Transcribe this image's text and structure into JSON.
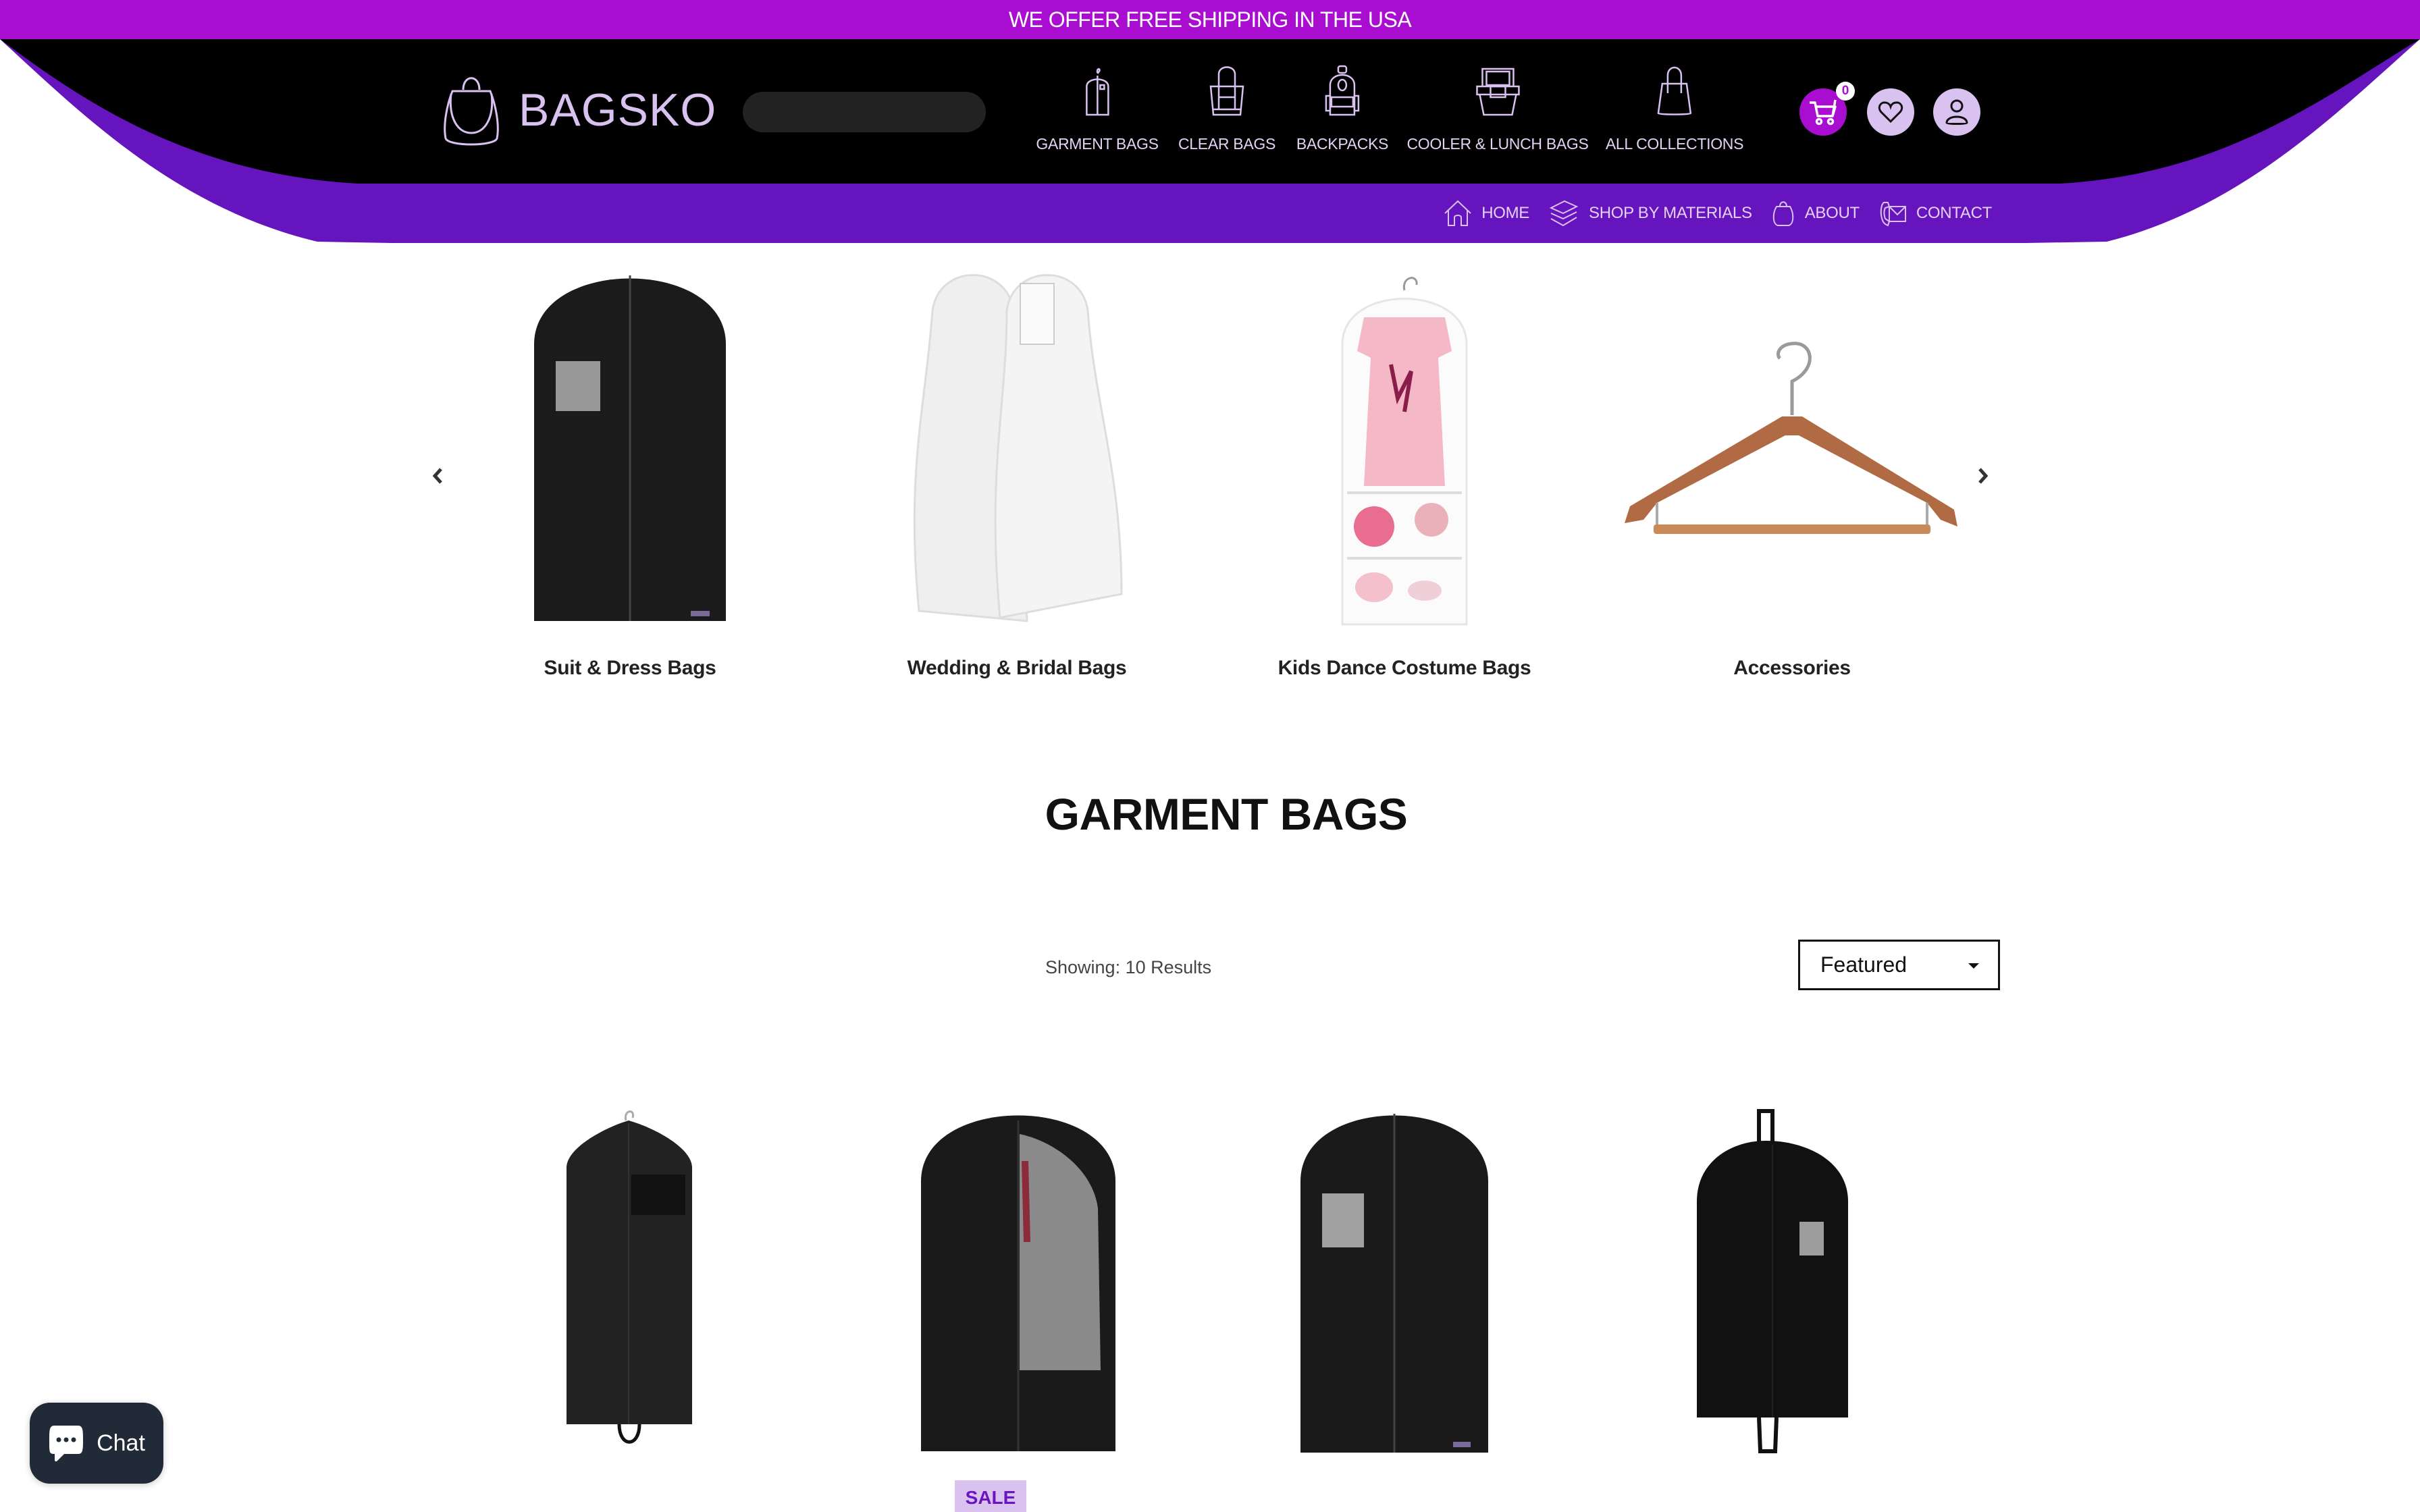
{
  "announcement": "WE OFFER FREE SHIPPING IN THE USA",
  "brand": {
    "name": "BAGSKO",
    "logo_icon": "bag-outline-icon"
  },
  "search": {
    "placeholder": "",
    "value": "",
    "icon": "search-icon"
  },
  "main_nav": [
    {
      "label": "GARMENT BAGS",
      "icon": "garment-bag-icon"
    },
    {
      "label": "CLEAR BAGS",
      "icon": "tote-bag-icon"
    },
    {
      "label": "BACKPACKS",
      "icon": "backpack-icon"
    },
    {
      "label": "COOLER & LUNCH BAGS",
      "icon": "cooler-icon"
    },
    {
      "label": "ALL COLLECTIONS",
      "icon": "shopping-bag-icon"
    }
  ],
  "header_actions": {
    "cart": {
      "icon": "cart-icon",
      "count": "0"
    },
    "wishlist": {
      "icon": "heart-icon"
    },
    "account": {
      "icon": "user-icon"
    }
  },
  "sub_nav": [
    {
      "label": "HOME",
      "icon": "home-icon"
    },
    {
      "label": "SHOP BY MATERIALS",
      "icon": "layers-icon"
    },
    {
      "label": "ABOUT",
      "icon": "bag-icon"
    },
    {
      "label": "CONTACT",
      "icon": "phone-mail-icon"
    }
  ],
  "categories": [
    {
      "label": "Suit & Dress Bags"
    },
    {
      "label": "Wedding & Bridal Bags"
    },
    {
      "label": "Kids Dance Costume Bags"
    },
    {
      "label": "Accessories"
    }
  ],
  "collection": {
    "title": "GARMENT BAGS",
    "showing": "Showing: 10 Results",
    "sort": {
      "selected": "Featured"
    }
  },
  "products": [
    {
      "image_desc": "black garment bag with hanger",
      "badge": ""
    },
    {
      "image_desc": "black garment bag with suit window",
      "badge": "SALE"
    },
    {
      "image_desc": "black garment bag with ID window",
      "badge": ""
    },
    {
      "image_desc": "black garment bag with handles",
      "badge": ""
    }
  ],
  "chat": {
    "label": "Chat"
  },
  "colors": {
    "announcement_bg": "#a80dd0",
    "header_bg": "#000000",
    "band_purple": "#6614bd",
    "lavender": "#d9c2ef",
    "chat_bg": "#212a37"
  }
}
